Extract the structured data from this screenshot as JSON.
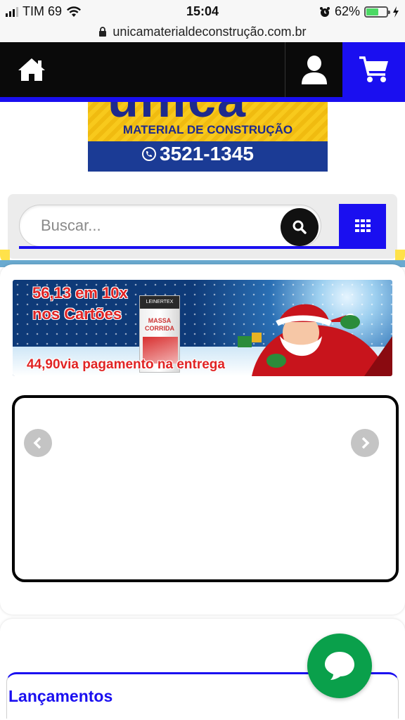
{
  "status_bar": {
    "carrier": "TIM 69",
    "time": "15:04",
    "battery_percent": "62%",
    "battery_level": 0.62,
    "icons": [
      "signal-icon",
      "wifi-icon",
      "alarm-icon",
      "battery-icon",
      "charging-icon"
    ]
  },
  "browser": {
    "url": "unicamaterialdeconstrução.com.br",
    "icons": [
      "lock-icon"
    ]
  },
  "header": {
    "icons": [
      "home-icon",
      "user-icon",
      "cart-icon"
    ],
    "accent_color": "#1a0ff0"
  },
  "logo": {
    "name": "unica",
    "tagline": "MATERIAL DE CONSTRUÇÃO",
    "phone": "3521-1345",
    "colors": {
      "yellow": "#f8c91c",
      "blue": "#1b3b95"
    }
  },
  "search": {
    "placeholder": "Buscar...",
    "icons": [
      "search-icon",
      "grid-menu-icon"
    ]
  },
  "promo_banner": {
    "line1": "56,13 em 10x",
    "line2": "nos Cartões",
    "line3": "44,90via pagamento na entrega",
    "product": {
      "brand": "LEINERTEX",
      "name": "MASSA CORRIDA"
    }
  },
  "carousel": {
    "icons": [
      "chevron-left-icon",
      "chevron-right-icon"
    ]
  },
  "sections": {
    "releases_title": "Lançamentos"
  },
  "chat": {
    "icons": [
      "chat-bubble-icon"
    ],
    "color": "#0aa04b"
  }
}
